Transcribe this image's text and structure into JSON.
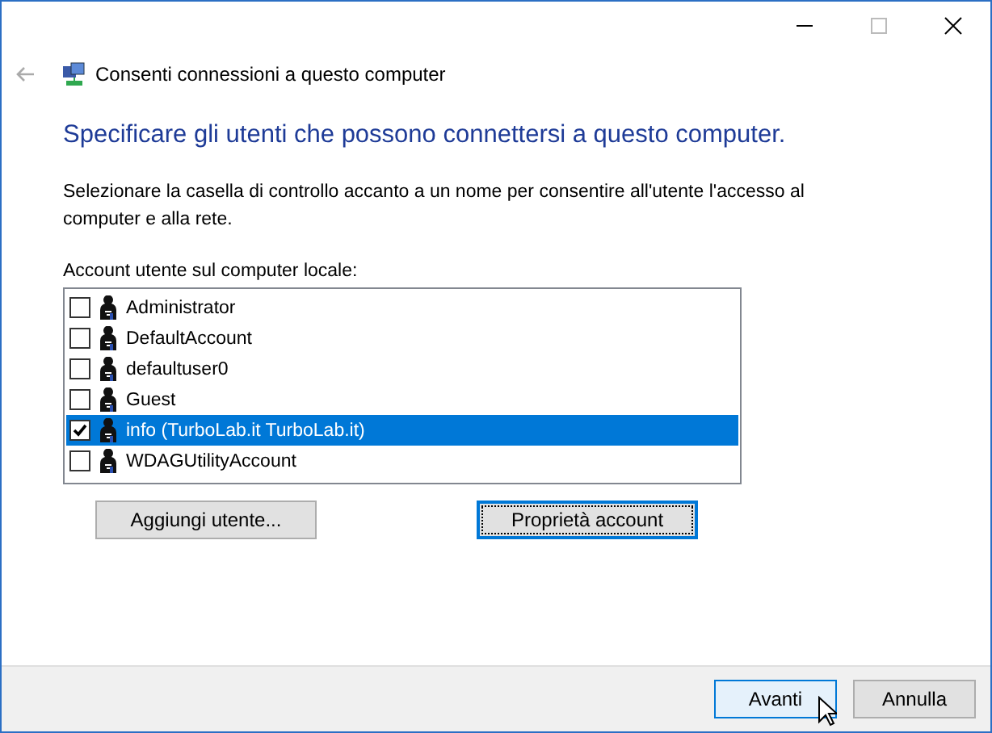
{
  "window": {
    "title": "Consenti connessioni a questo computer"
  },
  "heading": "Specificare gli utenti che possono connettersi a questo computer.",
  "description": "Selezionare la casella di controllo accanto a un nome per consentire all'utente l'accesso al computer e alla rete.",
  "accounts_label": "Account utente sul computer locale:",
  "accounts": [
    {
      "name": "Administrator",
      "checked": false,
      "selected": false
    },
    {
      "name": "DefaultAccount",
      "checked": false,
      "selected": false
    },
    {
      "name": "defaultuser0",
      "checked": false,
      "selected": false
    },
    {
      "name": "Guest",
      "checked": false,
      "selected": false
    },
    {
      "name": "info (TurboLab.it TurboLab.it)",
      "checked": true,
      "selected": true
    },
    {
      "name": "WDAGUtilityAccount",
      "checked": false,
      "selected": false
    }
  ],
  "list_buttons": [
    {
      "label": "Aggiungi utente...",
      "focused": false
    },
    {
      "label": "Proprietà account",
      "focused": true
    }
  ],
  "footer_buttons": [
    {
      "label": "Avanti",
      "default": true
    },
    {
      "label": "Annulla",
      "default": false
    }
  ]
}
